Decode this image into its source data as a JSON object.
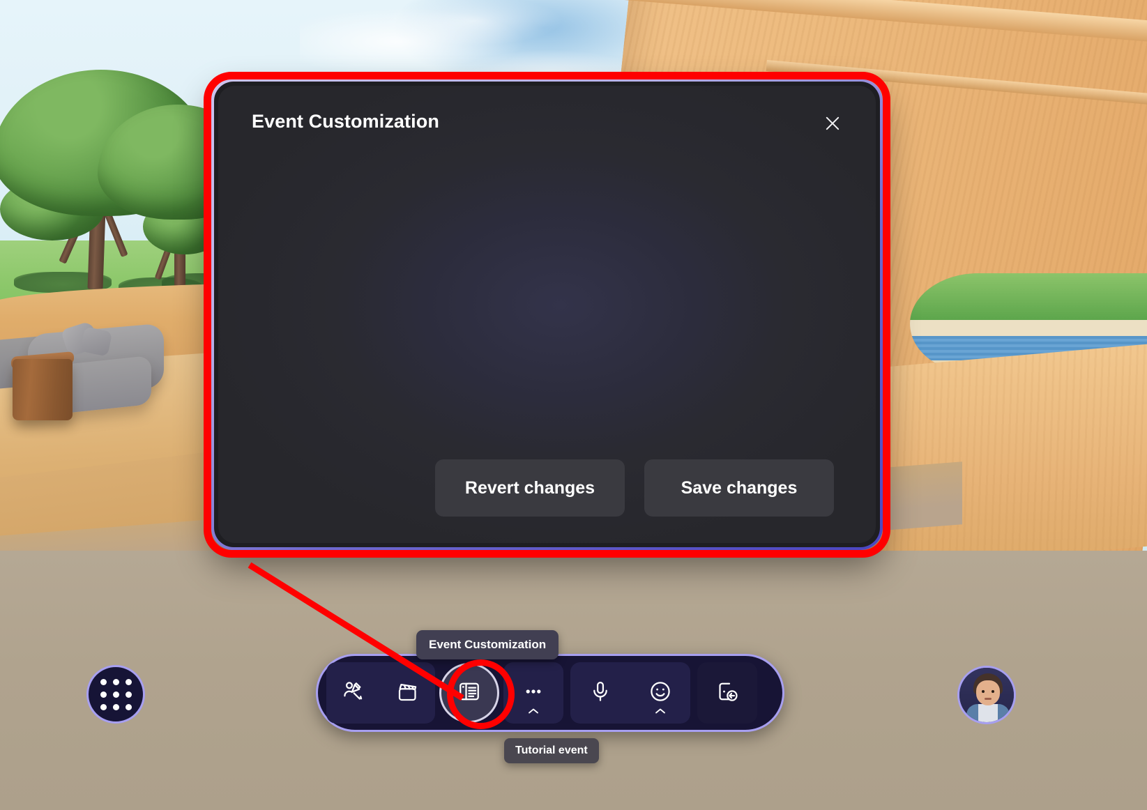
{
  "scene": {
    "name": "virtual-3d-lounge-environment",
    "description": "3D virtual meeting space with trees, wooden deck and furniture"
  },
  "dialog": {
    "title": "Event Customization",
    "close_icon": "close-icon",
    "buttons": {
      "revert_label": "Revert changes",
      "save_label": "Save changes"
    }
  },
  "annotation": {
    "color": "#ff0000",
    "target": "event-customization-toolbar-button"
  },
  "apps_button": {
    "icon": "app-grid-icon",
    "dots": [
      1,
      2,
      3,
      4,
      5,
      6,
      7,
      8,
      9
    ]
  },
  "toolbar": {
    "items": [
      {
        "name": "avatar-customize-icon",
        "label": "Customize avatar",
        "has_chevron": false,
        "active": false
      },
      {
        "name": "clapperboard-icon",
        "label": "Immersive spaces",
        "has_chevron": false,
        "active": false
      },
      {
        "name": "event-customization-icon",
        "label": "Event Customization",
        "has_chevron": false,
        "active": true
      },
      {
        "name": "more-options-icon",
        "label": "More",
        "has_chevron": true,
        "active": false
      },
      {
        "name": "microphone-icon",
        "label": "Mute",
        "has_chevron": false,
        "active": false
      },
      {
        "name": "reactions-smiley-icon",
        "label": "Reactions",
        "has_chevron": true,
        "active": false
      },
      {
        "name": "leave-call-icon",
        "label": "Leave",
        "has_chevron": false,
        "active": false
      }
    ]
  },
  "tooltips": {
    "event_customization": "Event Customization",
    "tutorial_event": "Tutorial event"
  },
  "avatar": {
    "name": "user-avatar"
  },
  "colors": {
    "annotation_red": "#ff0000",
    "accent_lavender": "#a79ff0",
    "toolbar_bg": "#171435",
    "dialog_bg": "#2a2a31",
    "button_bg": "#3a3a40",
    "tooltip_bg": "#413f52"
  }
}
